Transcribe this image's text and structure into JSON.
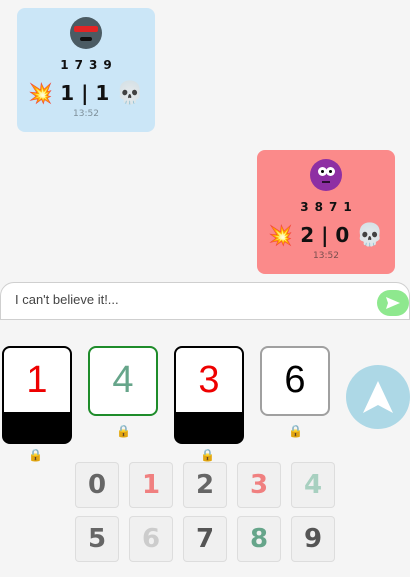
{
  "messages": [
    {
      "side": "left",
      "avatar": "robot-avatar",
      "guess": "1739",
      "hits": "1",
      "separator": "|",
      "deads": "1",
      "hit_icon": "💥",
      "dead_icon": "💀",
      "time": "13:52",
      "background": "#cbe6f7"
    },
    {
      "side": "right",
      "avatar": "purple-face-avatar",
      "guess": "3871",
      "hits": "2",
      "separator": "|",
      "deads": "0",
      "hit_icon": "💥",
      "dead_icon": "💀",
      "time": "13:52",
      "background": "#fb8a8a"
    }
  ],
  "chat": {
    "placeholder": "I can't believe it!...",
    "send_icon": "send-arrow-icon",
    "send_color": "#8ee88e"
  },
  "slots": [
    {
      "digit": "1",
      "color": "#ee0000",
      "style": "locked-black",
      "lock_icon": "lock-icon"
    },
    {
      "digit": "4",
      "color": "#66a58a",
      "style": "green-border",
      "lock_icon": "lock-icon"
    },
    {
      "digit": "3",
      "color": "#ee0000",
      "style": "locked-black",
      "lock_icon": "lock-icon"
    },
    {
      "digit": "6",
      "color": "#000000",
      "style": "grey-border",
      "lock_icon": "lock-icon"
    }
  ],
  "submit_button": {
    "icon": "navigation-arrow-icon",
    "color": "#add8e6"
  },
  "keypad": [
    {
      "digit": "0",
      "color": "#666666"
    },
    {
      "digit": "1",
      "color": "#f08080"
    },
    {
      "digit": "2",
      "color": "#666666"
    },
    {
      "digit": "3",
      "color": "#f08080"
    },
    {
      "digit": "4",
      "color": "#a8d0c0"
    },
    {
      "digit": "5",
      "color": "#666666"
    },
    {
      "digit": "6",
      "color": "#cccccc"
    },
    {
      "digit": "7",
      "color": "#555555"
    },
    {
      "digit": "8",
      "color": "#66a58a"
    },
    {
      "digit": "9",
      "color": "#555555"
    }
  ]
}
